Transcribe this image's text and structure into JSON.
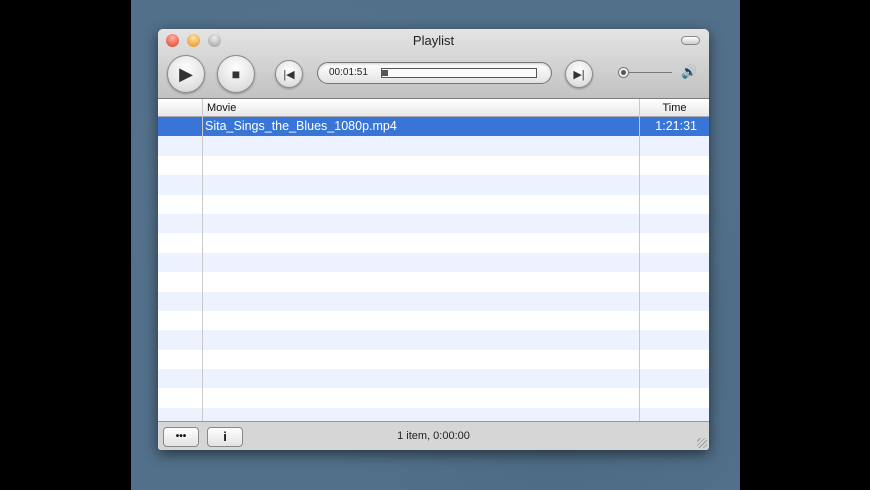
{
  "window": {
    "title": "Playlist"
  },
  "player": {
    "current_time": "00:01:51",
    "progress": 0.01
  },
  "columns": {
    "movie": "Movie",
    "time": "Time"
  },
  "rows": [
    {
      "movie": "Sita_Sings_the_Blues_1080p.mp4",
      "time": "1:21:31",
      "selected": true
    }
  ],
  "footer": {
    "actions_label": "•••",
    "info_label": "i",
    "status": "1 item, 0:00:00"
  },
  "colors": {
    "selection": "#3875d7",
    "stripe": "#edf3fe"
  }
}
